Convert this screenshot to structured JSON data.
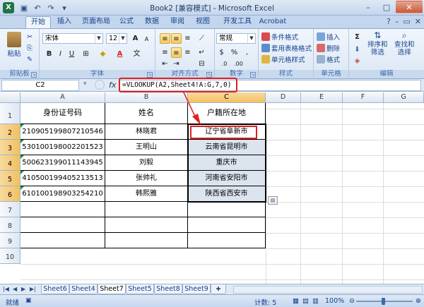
{
  "window": {
    "title": "Book2  [兼容模式] - Microsoft Excel",
    "app_icon": "excel-logo",
    "qat_icons": [
      "save-icon",
      "undo-icon",
      "redo-icon",
      "qat-customize-icon"
    ],
    "controls": [
      "minimize-icon",
      "maximize-icon",
      "close-icon"
    ]
  },
  "ribbon": {
    "tabs": [
      "开始",
      "插入",
      "页面布局",
      "公式",
      "数据",
      "审阅",
      "视图",
      "开发工具",
      "Acrobat"
    ],
    "active_tab": "开始",
    "clipboard": {
      "paste": "粘贴",
      "label": "剪贴板"
    },
    "font": {
      "name": "宋体",
      "size": "12",
      "bold": "B",
      "italic": "I",
      "underline": "U",
      "label": "字体",
      "grow": "A",
      "shrink": "A",
      "color_a": "A",
      "wen": "文"
    },
    "alignment": {
      "label": "对齐方式"
    },
    "number": {
      "format": "常规",
      "percent": "%",
      "comma": ",",
      "currency": "$",
      "label": "数字"
    },
    "styles": {
      "conditional": "条件格式",
      "table": "套用表格格式",
      "cell": "单元格样式",
      "label": "样式"
    },
    "cells": {
      "insert": "插入",
      "delete": "删除",
      "format": "格式",
      "label": "单元格"
    },
    "editing": {
      "sum": "Σ",
      "sort": "排序和\n筛选",
      "find": "查找和\n选择",
      "label": "编辑"
    }
  },
  "formula_bar": {
    "name_box": "C2",
    "fx": "fx",
    "formula": "=VLOOKUP(A2,Sheet4!A:G,7,0)"
  },
  "grid": {
    "columns": [
      "A",
      "B",
      "C",
      "D",
      "E",
      "F",
      "G"
    ],
    "rows": [
      "1",
      "2",
      "3",
      "4",
      "5",
      "6",
      "7",
      "8",
      "9",
      "10"
    ],
    "headers": [
      "身份证号码",
      "姓名",
      "户籍所在地"
    ],
    "data": [
      [
        "210905199807210546",
        "林晓君",
        "辽宁省阜新市"
      ],
      [
        "530100198002201523",
        "王明山",
        "云南省昆明市"
      ],
      [
        "500623199011143945",
        "刘毅",
        "重庆市"
      ],
      [
        "410500199405213513",
        "张帅礼",
        "河南省安阳市"
      ],
      [
        "610100198903254210",
        "韩熙雅",
        "陕西省西安市"
      ]
    ],
    "selected_cell": "C2"
  },
  "sheets": {
    "tabs": [
      "Sheet6",
      "Sheet4",
      "Sheet7",
      "Sheet5",
      "Sheet8",
      "Sheet9"
    ],
    "active": "Sheet7"
  },
  "status": {
    "mode": "就绪",
    "count": "计数: 5",
    "zoom": "100%"
  }
}
